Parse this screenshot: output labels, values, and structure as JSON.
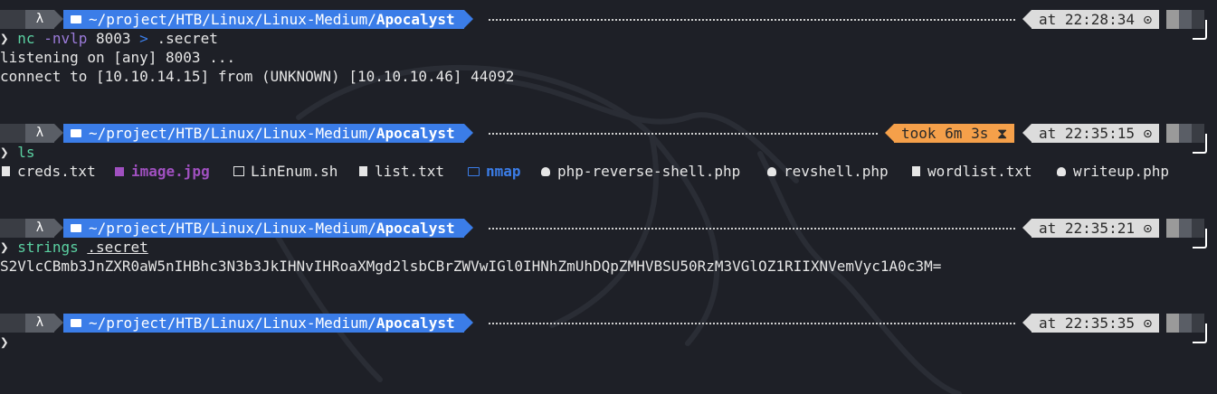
{
  "prompt_symbol": "❯",
  "blocks": [
    {
      "lambda": "λ",
      "path_prefix": "~/project/HTB/Linux/Linux-Medium/",
      "path_dir": "Apocalyst",
      "time": "at 22:28:34 ⊙",
      "command": {
        "name": "nc",
        "flags": "-nvlp",
        "arg": "8003",
        "redirect": ">",
        "target": ".secret"
      },
      "output": [
        "listening on [any] 8003 ...",
        "connect to [10.10.14.15] from (UNKNOWN) [10.10.10.46] 44092"
      ]
    },
    {
      "lambda": "λ",
      "path_prefix": "~/project/HTB/Linux/Linux-Medium/",
      "path_dir": "Apocalyst",
      "took": "took 6m 3s ⧗",
      "time": "at 22:35:15 ⊙",
      "command": {
        "name": "ls"
      },
      "listing": [
        {
          "name": "creds.txt",
          "icon": "file-icon",
          "kind": "file"
        },
        {
          "name": "image.jpg",
          "icon": "image-icon",
          "kind": "image"
        },
        {
          "name": "LinEnum.sh",
          "icon": "terminal-icon",
          "kind": "file"
        },
        {
          "name": "list.txt",
          "icon": "file-icon",
          "kind": "file"
        },
        {
          "name": "nmap",
          "icon": "folder-open-icon",
          "kind": "dir"
        },
        {
          "name": "php-reverse-shell.php",
          "icon": "php-elephant-icon",
          "kind": "file"
        },
        {
          "name": "revshell.php",
          "icon": "php-elephant-icon",
          "kind": "file"
        },
        {
          "name": "wordlist.txt",
          "icon": "file-icon",
          "kind": "file"
        },
        {
          "name": "writeup.php",
          "icon": "php-elephant-icon",
          "kind": "file"
        }
      ]
    },
    {
      "lambda": "λ",
      "path_prefix": "~/project/HTB/Linux/Linux-Medium/",
      "path_dir": "Apocalyst",
      "time": "at 22:35:21 ⊙",
      "command": {
        "name": "strings",
        "target": ".secret"
      },
      "output": [
        "S2VlcCBmb3JnZXR0aW5nIHBhc3N3b3JkIHNvIHRoaXMgd2lsbCBrZWVwIGl0IHNhZmUhDQpZMHVBSU50RzM3VGlOZ1RIIXNVemVyc1A0c3M="
      ]
    },
    {
      "lambda": "λ",
      "path_prefix": "~/project/HTB/Linux/Linux-Medium/",
      "path_dir": "Apocalyst",
      "time": "at 22:35:35 ⊙"
    }
  ],
  "colors": {
    "background": "#1e2027",
    "path_segment": "#3b7de8",
    "time_segment": "#dcdcdc",
    "took_segment": "#f5a04a",
    "command": "#5bd1a2",
    "flag": "#9b7bd9"
  }
}
